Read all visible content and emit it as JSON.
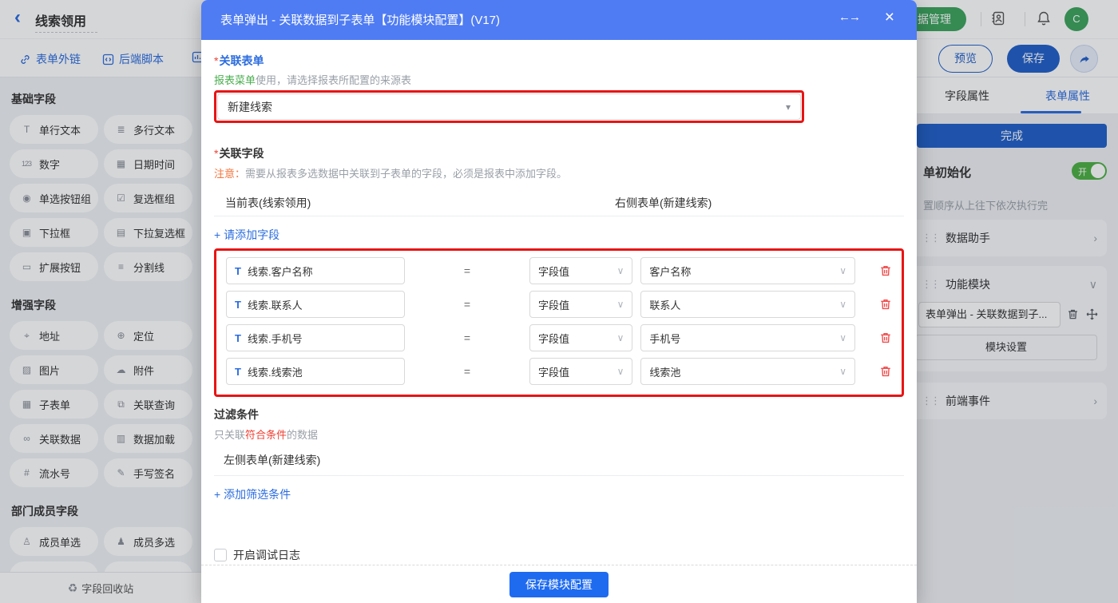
{
  "colors": {
    "modal_header_blue": "#4f7cf3",
    "link_blue": "#2b6cde",
    "primary_button_blue": "#1f6bf0",
    "dark_blue": "#2160c9",
    "green": "#3ca45c",
    "toggle_green": "#4cb043",
    "annotation_red": "#e81414",
    "warn_orange": "#f5743c",
    "danger_red": "#f04134"
  },
  "header": {
    "back_icon": "‹",
    "title": "线索领用",
    "data_manage_label": "据管理",
    "avatar_letter": "C"
  },
  "toolbar": {
    "form_link_label": "表单外链",
    "backend_script_label": "后端脚本",
    "preview_label": "预览",
    "save_label": "保存"
  },
  "sidebar": {
    "sections": [
      {
        "title": "基础字段",
        "items": [
          {
            "icon": "T",
            "label": "单行文本"
          },
          {
            "icon": "≣",
            "label": "多行文本"
          },
          {
            "icon": "123",
            "label": "数字"
          },
          {
            "icon": "▦",
            "label": "日期时间"
          },
          {
            "icon": "◉",
            "label": "单选按钮组"
          },
          {
            "icon": "☑",
            "label": "复选框组"
          },
          {
            "icon": "▣",
            "label": "下拉框"
          },
          {
            "icon": "▤",
            "label": "下拉复选框"
          },
          {
            "icon": "▭",
            "label": "扩展按钮"
          },
          {
            "icon": "≡",
            "label": "分割线"
          }
        ]
      },
      {
        "title": "增强字段",
        "items": [
          {
            "icon": "⌖",
            "label": "地址"
          },
          {
            "icon": "⊕",
            "label": "定位"
          },
          {
            "icon": "▨",
            "label": "图片"
          },
          {
            "icon": "☁",
            "label": "附件"
          },
          {
            "icon": "▦",
            "label": "子表单"
          },
          {
            "icon": "⧉",
            "label": "关联查询"
          },
          {
            "icon": "∞",
            "label": "关联数据"
          },
          {
            "icon": "▥",
            "label": "数据加载"
          },
          {
            "icon": "#",
            "label": "流水号"
          },
          {
            "icon": "✎",
            "label": "手写签名"
          }
        ]
      },
      {
        "title": "部门成员字段",
        "items": [
          {
            "icon": "♙",
            "label": "成员单选"
          },
          {
            "icon": "♟",
            "label": "成员多选"
          }
        ]
      }
    ],
    "recycle_icon": "♻",
    "recycle_label": "字段回收站"
  },
  "modal": {
    "title": "表单弹出 - 关联数据到子表单【功能模块配置】(V17)",
    "resize_icon": "←→",
    "close_icon": "×",
    "related_form": {
      "required_mark": "*",
      "label": "关联表单",
      "hint_green": "报表菜单",
      "hint_rest": "使用，请选择报表所配置的来源表",
      "value": "新建线索",
      "caret_icon": "▾"
    },
    "related_fields": {
      "required_mark": "*",
      "label": "关联字段",
      "note_label": "注意：",
      "note_text": "需要从报表多选数据中关联到子表单的字段，必须是报表中添加字段。",
      "left_header": "当前表(线索领用)",
      "right_header": "右侧表单(新建线索)",
      "add_label": "+ 请添加字段",
      "caret_icon": "∨",
      "rows": [
        {
          "icon": "T",
          "left": "线索.客户名称",
          "op": "=",
          "type": "字段值",
          "right": "客户名称"
        },
        {
          "icon": "T",
          "left": "线索.联系人",
          "op": "=",
          "type": "字段值",
          "right": "联系人"
        },
        {
          "icon": "T",
          "left": "线索.手机号",
          "op": "=",
          "type": "字段值",
          "right": "手机号"
        },
        {
          "icon": "T",
          "left": "线索.线索池",
          "op": "=",
          "type": "字段值",
          "right": "线索池"
        }
      ]
    },
    "filter": {
      "label": "过滤条件",
      "hint_pre": "只关联",
      "hint_highlight": "符合条件",
      "hint_post": "的数据",
      "table_label": "左侧表单(新建线索)",
      "add_label": "+ 添加筛选条件"
    },
    "debug_label": "开启调试日志",
    "save_button": "保存模块配置"
  },
  "right_panel": {
    "drag_icon": "⋮⋮",
    "tabs": [
      {
        "label": "字段属性"
      },
      {
        "label": "表单属性"
      }
    ],
    "done_label": "完成",
    "form_init": {
      "label": "单初始化",
      "toggle_text": "开",
      "description": "置顺序从上往下依次执行完"
    },
    "data_helper": {
      "label": "数据助手",
      "chevron": "›"
    },
    "function_module": {
      "label": "功能模块",
      "chevron": "∨",
      "module_name": "表单弹出 - 关联数据到子...",
      "settings_label": "模块设置"
    },
    "frontend_event": {
      "label": "前端事件",
      "chevron": "›"
    }
  }
}
